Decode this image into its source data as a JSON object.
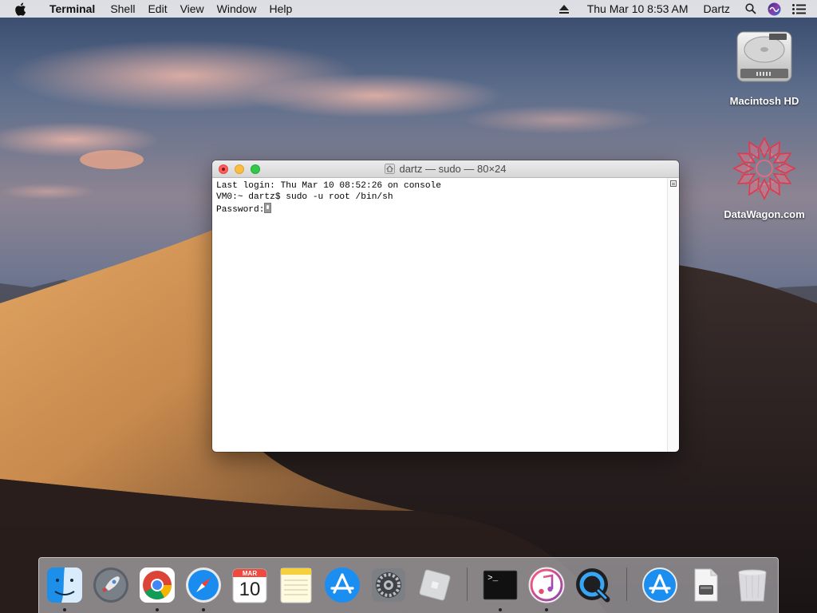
{
  "menubar": {
    "apple_icon": "apple-logo-icon",
    "app_name": "Terminal",
    "menus": [
      "Shell",
      "Edit",
      "View",
      "Window",
      "Help"
    ],
    "eject_icon": "eject-icon",
    "clock": "Thu Mar 10  8:53 AM",
    "user": "Dartz",
    "search_icon": "spotlight-search-icon",
    "siri_icon": "siri-icon",
    "notifications_icon": "notification-center-icon"
  },
  "desktop": {
    "icons": [
      {
        "label": "Macintosh HD",
        "icon": "hard-drive-icon"
      },
      {
        "label": "DataWagon.com",
        "icon": "datawagon-mandala-icon"
      }
    ]
  },
  "terminal_window": {
    "title": "dartz — sudo — 80×24",
    "title_icon": "home-folder-icon",
    "lines": [
      "Last login: Thu Mar 10 08:52:26 on console",
      "VM0:~ dartz$ sudo -u root /bin/sh",
      "Password:"
    ],
    "cursor_icon": "secure-input-key-cursor"
  },
  "dock": {
    "items": [
      {
        "name": "Finder",
        "icon": "finder-icon",
        "running": true
      },
      {
        "name": "Launchpad",
        "icon": "launchpad-rocket-icon",
        "running": false
      },
      {
        "name": "Google Chrome",
        "icon": "chrome-icon",
        "running": true
      },
      {
        "name": "Safari",
        "icon": "safari-compass-icon",
        "running": true
      },
      {
        "name": "Calendar",
        "icon": "calendar-icon",
        "running": false,
        "month": "MAR",
        "day": "10"
      },
      {
        "name": "Notes",
        "icon": "notes-icon",
        "running": false
      },
      {
        "name": "App Store",
        "icon": "app-store-icon",
        "running": false
      },
      {
        "name": "System Preferences",
        "icon": "gear-icon",
        "running": false
      },
      {
        "name": "Roblox",
        "icon": "roblox-icon",
        "running": false
      },
      {
        "name": "Terminal",
        "icon": "terminal-icon",
        "running": true,
        "prompt": ">_"
      },
      {
        "name": "iTunes",
        "icon": "itunes-music-icon",
        "running": true
      },
      {
        "name": "QuickTime Player",
        "icon": "quicktime-icon",
        "running": false
      },
      {
        "name": "Applications",
        "icon": "applications-folder-icon",
        "running": false
      },
      {
        "name": "Document",
        "icon": "document-stack-icon",
        "running": false
      },
      {
        "name": "Trash",
        "icon": "trash-icon",
        "running": false
      }
    ]
  }
}
